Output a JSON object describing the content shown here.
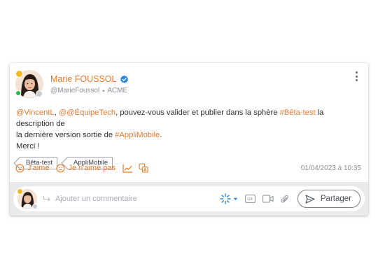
{
  "post": {
    "author_name": "Marie FOUSSOL",
    "author_handle": "@MarieFoussol",
    "meta_separator": "•",
    "organization": "ACME",
    "body": {
      "mention1": "@VincentL",
      "comma1": ", ",
      "mention2": "@@ÉquipeTech",
      "text1": ", pouvez-vous valider et publier dans la sphère ",
      "hashtag1": "#Bêta-test",
      "text2": " la description de",
      "text3": "la dernière version sortie de ",
      "hashtag2": "#AppliMobile",
      "text4": ".",
      "closing": "Merci !"
    },
    "tags": [
      "Bêta-test",
      "AppliMobile"
    ],
    "actions": {
      "like_label": "J'aime",
      "dislike_label": "Je n'aime pas"
    },
    "date": "01/04/2023 à 10:35"
  },
  "comment": {
    "placeholder": "Ajouter un commentaire",
    "share_label": "Partager"
  },
  "colors": {
    "accent": "#e77a2c",
    "verified": "#2f86d6",
    "online": "#2fb24c"
  },
  "icons": [
    "verified-icon",
    "more-icon",
    "smile-icon",
    "frown-icon",
    "stats-icon",
    "translate-icon",
    "reply-icon",
    "sparkle-icon",
    "gif-icon",
    "video-icon",
    "attachment-icon",
    "send-icon"
  ]
}
